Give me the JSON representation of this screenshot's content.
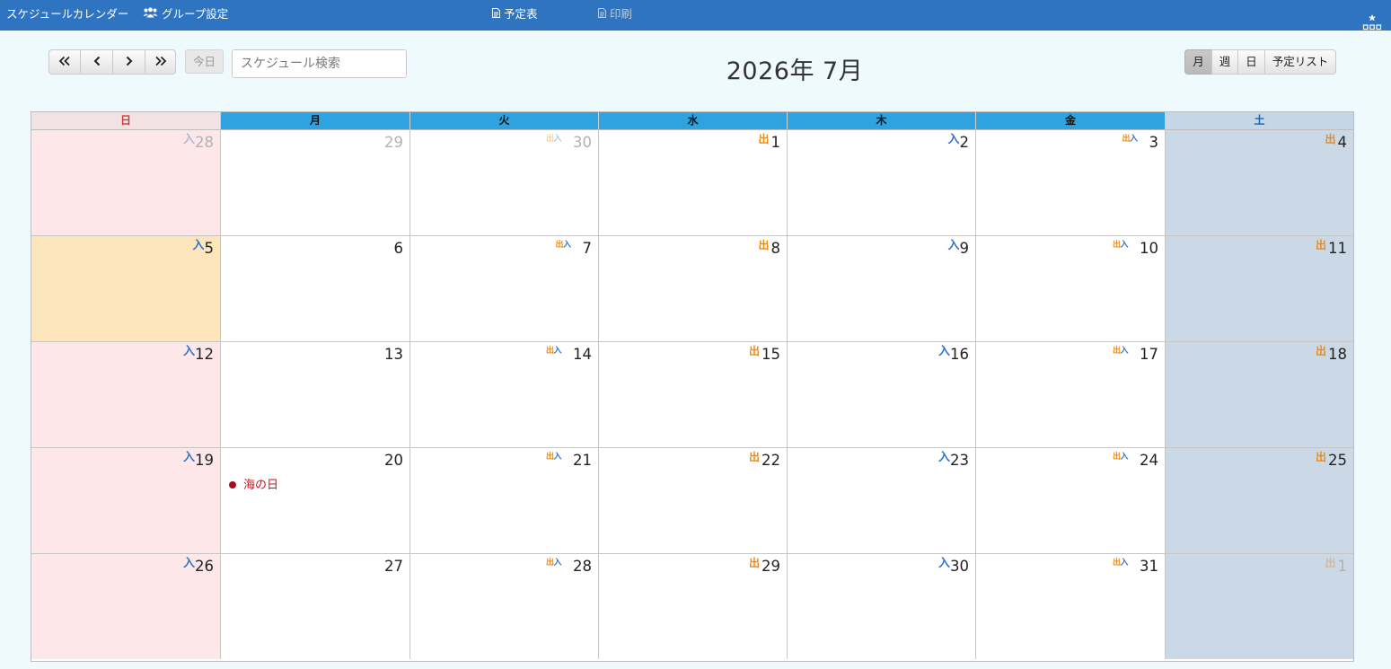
{
  "topbar": {
    "app_title": "スケジュールカレンダー",
    "group_settings": "グループ設定",
    "schedule_table": "予定表",
    "print": "印刷",
    "bg_color": "#2f74c0"
  },
  "toolbar": {
    "today_label": "今日",
    "search_placeholder": "スケジュール検索",
    "month_title": "2026年 7月",
    "views": [
      {
        "label": "月",
        "active": true
      },
      {
        "label": "週",
        "active": false
      },
      {
        "label": "日",
        "active": false
      },
      {
        "label": "予定リスト",
        "active": false
      }
    ]
  },
  "calendar": {
    "weekdays": [
      "日",
      "月",
      "火",
      "水",
      "木",
      "金",
      "土"
    ],
    "today": "5",
    "colors": {
      "out": "#ee8a12",
      "in": "#2f74c9",
      "event": "#c8141c",
      "weekday_header": "#2ea3df"
    },
    "weeks": [
      [
        {
          "day": "28",
          "other": true,
          "mark": "入"
        },
        {
          "day": "29",
          "other": true
        },
        {
          "day": "30",
          "other": true,
          "mark": "出入"
        },
        {
          "day": "1",
          "mark": "出"
        },
        {
          "day": "2",
          "mark": "入"
        },
        {
          "day": "3",
          "mark": "出入"
        },
        {
          "day": "4",
          "mark": "出"
        }
      ],
      [
        {
          "day": "5",
          "mark": "入",
          "today": true
        },
        {
          "day": "6"
        },
        {
          "day": "7",
          "mark": "出入"
        },
        {
          "day": "8",
          "mark": "出"
        },
        {
          "day": "9",
          "mark": "入"
        },
        {
          "day": "10",
          "mark": "出入"
        },
        {
          "day": "11",
          "mark": "出"
        }
      ],
      [
        {
          "day": "12",
          "mark": "入"
        },
        {
          "day": "13"
        },
        {
          "day": "14",
          "mark": "出入"
        },
        {
          "day": "15",
          "mark": "出"
        },
        {
          "day": "16",
          "mark": "入"
        },
        {
          "day": "17",
          "mark": "出入"
        },
        {
          "day": "18",
          "mark": "出"
        }
      ],
      [
        {
          "day": "19",
          "mark": "入"
        },
        {
          "day": "20",
          "event": "海の日"
        },
        {
          "day": "21",
          "mark": "出入"
        },
        {
          "day": "22",
          "mark": "出"
        },
        {
          "day": "23",
          "mark": "入"
        },
        {
          "day": "24",
          "mark": "出入"
        },
        {
          "day": "25",
          "mark": "出"
        }
      ],
      [
        {
          "day": "26",
          "mark": "入"
        },
        {
          "day": "27"
        },
        {
          "day": "28",
          "mark": "出入"
        },
        {
          "day": "29",
          "mark": "出"
        },
        {
          "day": "30",
          "mark": "入"
        },
        {
          "day": "31",
          "mark": "出入"
        },
        {
          "day": "1",
          "other": true,
          "mark": "出"
        }
      ]
    ]
  }
}
